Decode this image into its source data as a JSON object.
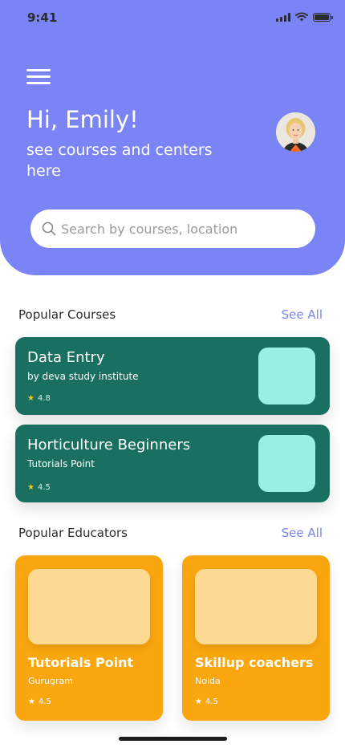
{
  "status_bar": {
    "time": "9:41"
  },
  "header": {
    "greeting": "Hi, Emily!",
    "subtitle": "see courses and centers here",
    "search": {
      "placeholder": "Search by courses, location"
    }
  },
  "popular_courses": {
    "title": "Popular Courses",
    "see_all": "See All",
    "items": [
      {
        "title": "Data Entry",
        "provider": "by deva study institute",
        "rating": "4.8"
      },
      {
        "title": "Horticulture Beginners",
        "provider": "Tutorials Point",
        "rating": "4.5"
      }
    ]
  },
  "popular_educators": {
    "title": "Popular Educators",
    "see_all": "See All",
    "items": [
      {
        "name": "Tutorials Point",
        "location": "Gurugram",
        "rating": "4.5"
      },
      {
        "name": "Skillup coachers",
        "location": "Noida",
        "rating": "4.5"
      }
    ]
  },
  "colors": {
    "header": "#7a84f4",
    "course_card": "#1a7060",
    "course_thumb": "#98f0e3",
    "educator_card": "#faa60f",
    "educator_thumb": "#fdd993",
    "accent": "#7a84f4"
  }
}
